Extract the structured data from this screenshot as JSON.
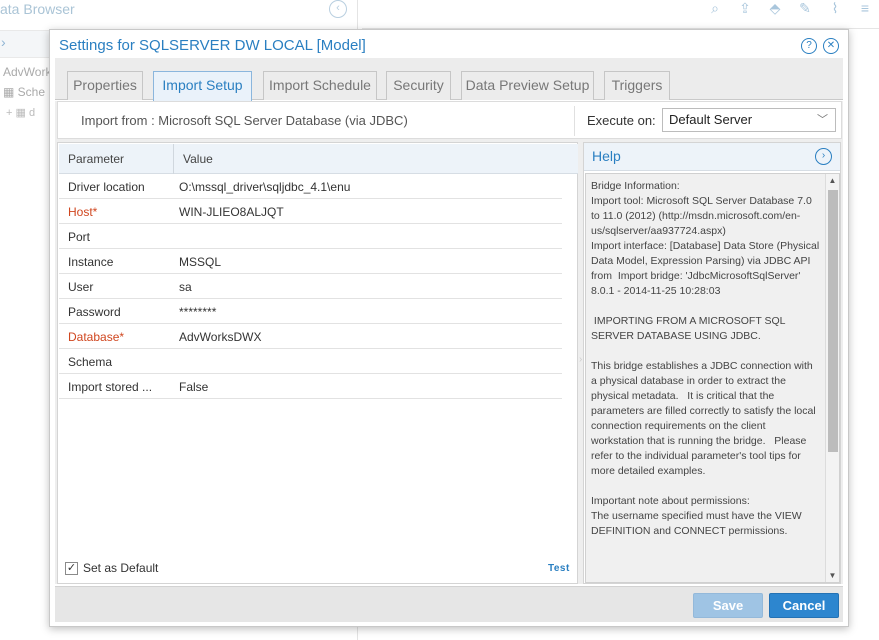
{
  "background": {
    "panel_title": "ata Browser",
    "tree_item_1": "AdvWorks",
    "tree_item_2": "Sche",
    "tree_item_3": "d"
  },
  "dialog": {
    "title": "Settings for SQLSERVER DW LOCAL [Model]",
    "tabs": [
      {
        "label": "Properties",
        "active": false
      },
      {
        "label": "Import Setup",
        "active": true
      },
      {
        "label": "Import Schedule",
        "active": false
      },
      {
        "label": "Security",
        "active": false
      },
      {
        "label": "Data Preview Setup",
        "active": false
      },
      {
        "label": "Triggers",
        "active": false
      }
    ],
    "import_from": "Import from : Microsoft SQL Server Database (via JDBC)",
    "execute_on_label": "Execute on:",
    "execute_on_value": "Default Server",
    "table": {
      "col_param": "Parameter",
      "col_value": "Value",
      "rows": [
        {
          "name": "Driver location",
          "value": "O:\\mssql_driver\\sqljdbc_4.1\\enu",
          "required": false
        },
        {
          "name": "Host*",
          "value": "WIN-JLIEO8ALJQT",
          "required": true
        },
        {
          "name": "Port",
          "value": "",
          "required": false
        },
        {
          "name": "Instance",
          "value": "MSSQL",
          "required": false
        },
        {
          "name": "User",
          "value": "sa",
          "required": false
        },
        {
          "name": "Password",
          "value": "********",
          "required": false
        },
        {
          "name": "Database*",
          "value": "AdvWorksDWX",
          "required": true
        },
        {
          "name": "Schema",
          "value": "",
          "required": false
        },
        {
          "name": "Import stored ...",
          "value": "False",
          "required": false
        }
      ]
    },
    "set_default_label": "Set as Default",
    "test_label": "Test",
    "help": {
      "title": "Help",
      "text": "Bridge Information:\nImport tool: Microsoft SQL Server Database 7.0 to 11.0 (2012) (http://msdn.microsoft.com/en-us/sqlserver/aa937724.aspx)\nImport interface: [Database] Data Store (Physical Data Model, Expression Parsing) via JDBC API from  Import bridge: 'JdbcMicrosoftSqlServer' 8.0.1 - 2014-11-25 10:28:03\n\n IMPORTING FROM A MICROSOFT SQL SERVER DATABASE USING JDBC.\n\nThis bridge establishes a JDBC connection with a physical database in order to extract the physical metadata.   It is critical that the parameters are filled correctly to satisfy the local connection requirements on the client workstation that is running the bridge.   Please refer to the individual parameter's tool tips for more detailed examples.\n\nImportant note about permissions:\nThe username specified must have the VIEW DEFINITION and CONNECT permissions."
    },
    "save_label": "Save",
    "cancel_label": "Cancel"
  }
}
